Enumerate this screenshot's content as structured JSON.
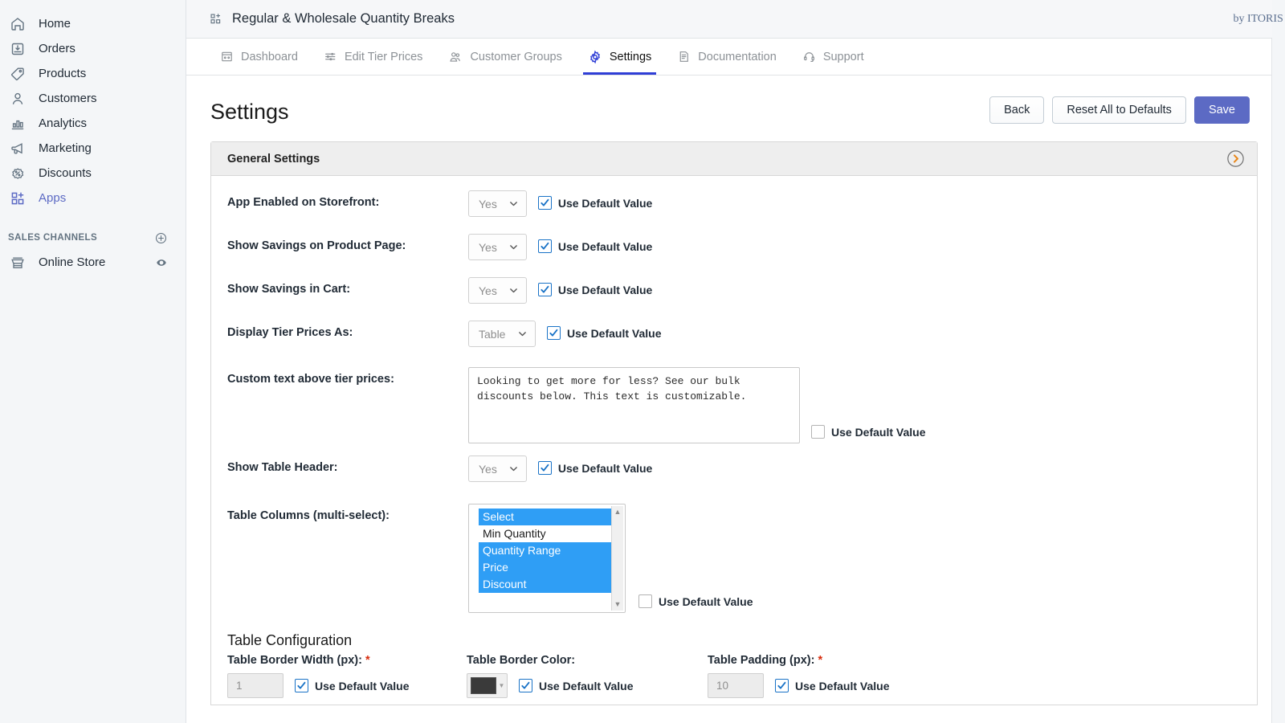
{
  "sidebar": {
    "items": [
      {
        "label": "Home",
        "icon": "home-icon",
        "active": false
      },
      {
        "label": "Orders",
        "icon": "orders-icon",
        "active": false
      },
      {
        "label": "Products",
        "icon": "tag-icon",
        "active": false
      },
      {
        "label": "Customers",
        "icon": "person-icon",
        "active": false
      },
      {
        "label": "Analytics",
        "icon": "bar-chart-icon",
        "active": false
      },
      {
        "label": "Marketing",
        "icon": "megaphone-icon",
        "active": false
      },
      {
        "label": "Discounts",
        "icon": "percent-badge-icon",
        "active": false
      },
      {
        "label": "Apps",
        "icon": "apps-grid-plus-icon",
        "active": true
      }
    ],
    "sales_channels": {
      "heading": "SALES CHANNELS",
      "add_icon": "plus-circle-icon",
      "items": [
        {
          "label": "Online Store",
          "icon": "storefront-icon",
          "action_icon": "eye-icon"
        }
      ]
    }
  },
  "header": {
    "app_icon": "apps-grid-icon",
    "title": "Regular & Wholesale Quantity Breaks",
    "byline": "by ITORIS I"
  },
  "tabs": [
    {
      "label": "Dashboard",
      "icon": "dashboard-grid-icon",
      "active": false
    },
    {
      "label": "Edit Tier Prices",
      "icon": "sliders-icon",
      "active": false
    },
    {
      "label": "Customer Groups",
      "icon": "people-icon",
      "active": false
    },
    {
      "label": "Settings",
      "icon": "gear-icon",
      "active": true
    },
    {
      "label": "Documentation",
      "icon": "document-icon",
      "active": false
    },
    {
      "label": "Support",
      "icon": "headset-icon",
      "active": false
    }
  ],
  "page": {
    "title": "Settings",
    "buttons": {
      "back": "Back",
      "reset": "Reset All to Defaults",
      "save": "Save"
    }
  },
  "panel": {
    "heading": "General Settings",
    "collapse_icon": "chevron-right-circle-icon"
  },
  "use_default_label": "Use Default Value",
  "fields": [
    {
      "label": "App Enabled on Storefront:",
      "type": "select",
      "value": "Yes",
      "use_default": true
    },
    {
      "label": "Show Savings on Product Page:",
      "type": "select",
      "value": "Yes",
      "use_default": true
    },
    {
      "label": "Show Savings in Cart:",
      "type": "select",
      "value": "Yes",
      "use_default": true
    },
    {
      "label": "Display Tier Prices As:",
      "type": "select",
      "value": "Table",
      "use_default": true
    }
  ],
  "custom_text": {
    "label": "Custom text above tier prices:",
    "value": "Looking to get more for less? See our bulk discounts below. This text is customizable.",
    "use_default": false
  },
  "show_table_header": {
    "label": "Show Table Header:",
    "value": "Yes",
    "use_default": true
  },
  "table_columns": {
    "label": "Table Columns (multi-select):",
    "options": [
      {
        "label": "Select",
        "selected": true
      },
      {
        "label": "Min Quantity",
        "selected": false
      },
      {
        "label": "Quantity Range",
        "selected": true
      },
      {
        "label": "Price",
        "selected": true
      },
      {
        "label": "Discount",
        "selected": true
      }
    ],
    "use_default": false
  },
  "table_configuration": {
    "heading": "Table Configuration",
    "border_width": {
      "label": "Table Border Width (px):",
      "required": true,
      "value": "1",
      "use_default": true
    },
    "border_color": {
      "label": "Table Border Color:",
      "required": false,
      "value": "#3a3a3a",
      "use_default": true
    },
    "padding": {
      "label": "Table Padding (px):",
      "required": true,
      "value": "10",
      "use_default": true
    }
  },
  "colors": {
    "accent": "#5c6ac4",
    "tab_active": "#2f3ed6",
    "checkbox_blue": "#1a73c7",
    "option_highlight": "#2f9ef5",
    "required_red": "#d72c0d",
    "chevron_orange": "#e8871a"
  }
}
